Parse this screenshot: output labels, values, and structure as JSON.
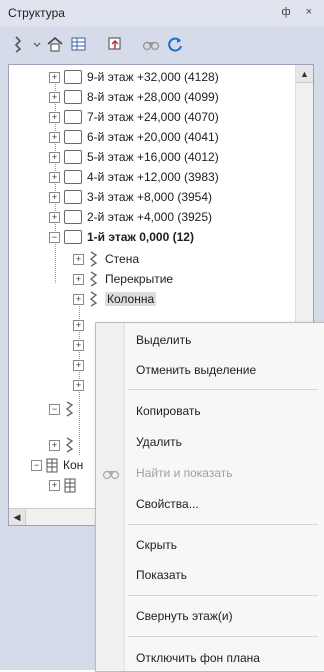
{
  "panel": {
    "title": "Структура",
    "title_buttons": "ф ×"
  },
  "toolbar": {
    "icons": [
      "structure-filter-icon",
      "dropdown-icon",
      "home-icon",
      "grid-view-icon",
      "layers-icon",
      "binoculars-icon",
      "refresh-icon"
    ]
  },
  "tree": {
    "floors": [
      {
        "label": "9-й этаж +32,000 (4128)"
      },
      {
        "label": "8-й этаж +28,000 (4099)"
      },
      {
        "label": "7-й этаж +24,000 (4070)"
      },
      {
        "label": "6-й этаж +20,000 (4041)"
      },
      {
        "label": "5-й этаж +16,000 (4012)"
      },
      {
        "label": "4-й этаж +12,000 (3983)"
      },
      {
        "label": "3-й этаж +8,000 (3954)"
      },
      {
        "label": "2-й этаж +4,000 (3925)"
      },
      {
        "label": "1-й этаж 0,000 (12)"
      }
    ],
    "children": [
      {
        "label": "Стена"
      },
      {
        "label": "Перекрытие"
      },
      {
        "label": "Колонна"
      }
    ],
    "bottom_item": {
      "label": "Кон"
    }
  },
  "context_menu": {
    "items": [
      {
        "label": "Выделить"
      },
      {
        "label": "Отменить выделение"
      },
      {
        "label": "Копировать"
      },
      {
        "label": "Удалить"
      },
      {
        "label": "Найти и показать"
      },
      {
        "label": "Свойства..."
      },
      {
        "label": "Скрыть"
      },
      {
        "label": "Показать"
      },
      {
        "label": "Свернуть этаж(и)"
      },
      {
        "label": "Отключить фон плана"
      }
    ]
  }
}
